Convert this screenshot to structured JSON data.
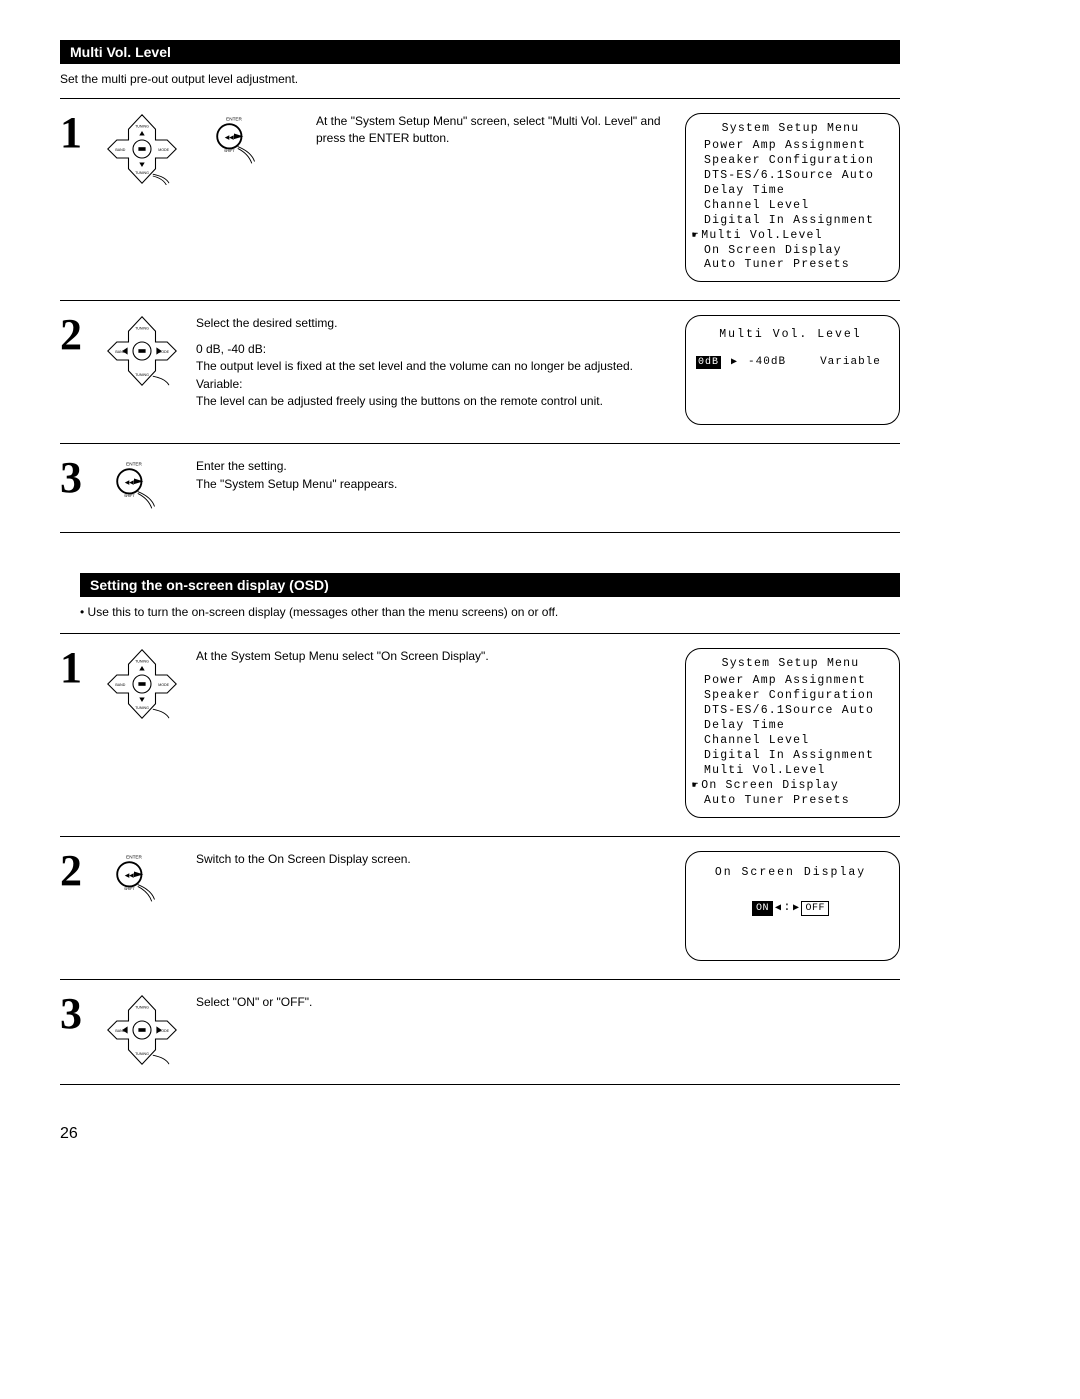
{
  "section1": {
    "title": "Multi Vol. Level",
    "intro": "Set the multi pre-out output level adjustment."
  },
  "osd_menu": {
    "title": "System Setup Menu",
    "items": [
      "Power Amp Assignment",
      "Speaker Configuration",
      "DTS-ES/6.1Source Auto",
      "Delay Time",
      "Channel Level",
      "Digital In Assignment",
      "Multi Vol.Level",
      "On Screen Display",
      "Auto Tuner Presets"
    ]
  },
  "s1": {
    "step1_text": "At the \"System Setup Menu\" screen, select \"Multi Vol. Level\" and press the ENTER button.",
    "step2_a": "Select the desired settimg.",
    "step2_b_head": "0 dB, -40 dB:",
    "step2_b_body": "The output level is fixed at the set level and the volume can no longer be adjusted.",
    "step2_c_head": "Variable:",
    "step2_c_body": "The level can be adjusted freely using the buttons on the remote control unit.",
    "step2_display_title": "Multi Vol. Level",
    "step2_opts": {
      "a": "0dB",
      "b": "-40dB",
      "c": "Variable"
    },
    "step3_a": "Enter the setting.",
    "step3_b": "The \"System Setup Menu\" reappears."
  },
  "section2": {
    "title": "Setting the on-screen display (OSD)",
    "bullet1": "Use this to turn the on-screen display (messages other than the menu screens) on or off."
  },
  "s2": {
    "step1_text": "At the System Setup Menu select \"On Screen Display\".",
    "step2_text": "Switch to the On Screen Display screen.",
    "step2_display_title": "On Screen Display",
    "step2_opts": {
      "on": "ON",
      "off": "OFF"
    },
    "step3_text": "Select \"ON\" or \"OFF\"."
  },
  "page_number": "26",
  "icons": {
    "dpad": "remote-dpad-icon",
    "enter": "enter-button-icon"
  }
}
